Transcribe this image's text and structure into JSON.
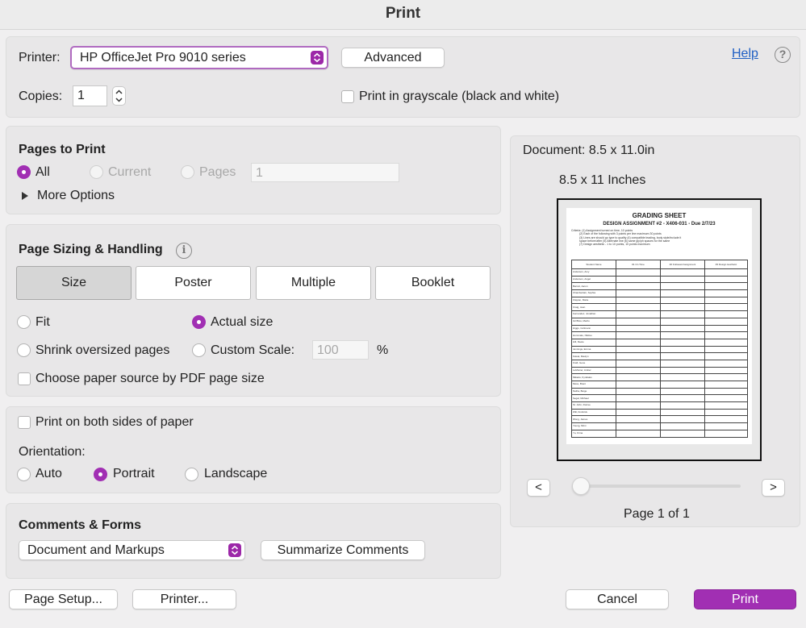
{
  "window": {
    "title": "Print"
  },
  "printer_section": {
    "printer_label": "Printer:",
    "printer_value": "HP OfficeJet Pro 9010 series",
    "advanced_label": "Advanced",
    "help_label": "Help",
    "help_icon_glyph": "?",
    "copies_label": "Copies:",
    "copies_value": "1",
    "grayscale_label": "Print in grayscale (black and white)",
    "grayscale_checked": false
  },
  "pages_to_print": {
    "heading": "Pages to Print",
    "all_label": "All",
    "current_label": "Current",
    "pages_label": "Pages",
    "pages_value": "1",
    "selected": "All",
    "more_options_label": "More Options"
  },
  "page_sizing": {
    "heading": "Page Sizing & Handling",
    "info_icon_glyph": "i",
    "tabs": [
      "Size",
      "Poster",
      "Multiple",
      "Booklet"
    ],
    "active_tab": "Size",
    "fit_label": "Fit",
    "actual_size_label": "Actual size",
    "shrink_label": "Shrink oversized pages",
    "custom_scale_label": "Custom Scale:",
    "custom_scale_value": "100",
    "percent_label": "%",
    "selected": "Actual size",
    "paper_source_label": "Choose paper source by PDF page size"
  },
  "duplex": {
    "both_sides_label": "Print on both sides of paper",
    "orientation_label": "Orientation:",
    "auto_label": "Auto",
    "portrait_label": "Portrait",
    "landscape_label": "Landscape",
    "selected": "Portrait"
  },
  "comments_forms": {
    "heading": "Comments & Forms",
    "value": "Document and Markups",
    "summarize_label": "Summarize Comments"
  },
  "preview": {
    "document_size": "Document: 8.5 x 11.0in",
    "paper_size": "8.5 x 11 Inches",
    "prev_label": "<",
    "next_label": ">",
    "page_indicator": "Page 1 of 1",
    "sheet": {
      "title": "GRADING SHEET",
      "subtitle": "DESIGN ASSIGNMENT #2 - X406-031 - Due 2/7/23",
      "criteria": [
        "Criteria: (1) Assignment turned on time, 10 points",
        "(2) Each of the following with 3 points per line maximum 30 points",
        "(3) Lines are should go type to quality (4) compatible leading, body style/include it",
        "space before/after (5) Alternate line (6) same gly/ph spaces for the same",
        "(7) Design aesthetic - 1 to 10 points, 10 points maximum"
      ],
      "table_headers": [
        "Student Name",
        "#1 On Time",
        "#2 Followed Assignment",
        "#3 Design Aesthetic"
      ],
      "names": [
        "Anderson, Amy",
        "Anderson, Angel",
        "Barrett, Aaron",
        "Chamberlain, Sophia",
        "Clayton, Marie",
        "Craig, Jean",
        "Fernandez, Jonathan",
        "Gil Bliss, Marilu",
        "Higgs, Coltmann",
        "Hummatu, Nikitsu",
        "Hill, Reele",
        "Jennings, Emma",
        "Kawai, Maulyn",
        "Kraft, Gene",
        "LeMonier, Amber",
        "Mikadu, Kyndales",
        "Moss, Brent",
        "Natha, Beige",
        "Segal, Michael",
        "St. John, Dorree",
        "Will, Kimbrick",
        "Wong, James",
        "Young, Mimi",
        "Yu, Krina"
      ]
    }
  },
  "footer": {
    "page_setup_label": "Page Setup...",
    "printer_label": "Printer...",
    "cancel_label": "Cancel",
    "print_label": "Print"
  },
  "colors": {
    "accent": "#a12fb3",
    "link": "#1f5fc4"
  }
}
